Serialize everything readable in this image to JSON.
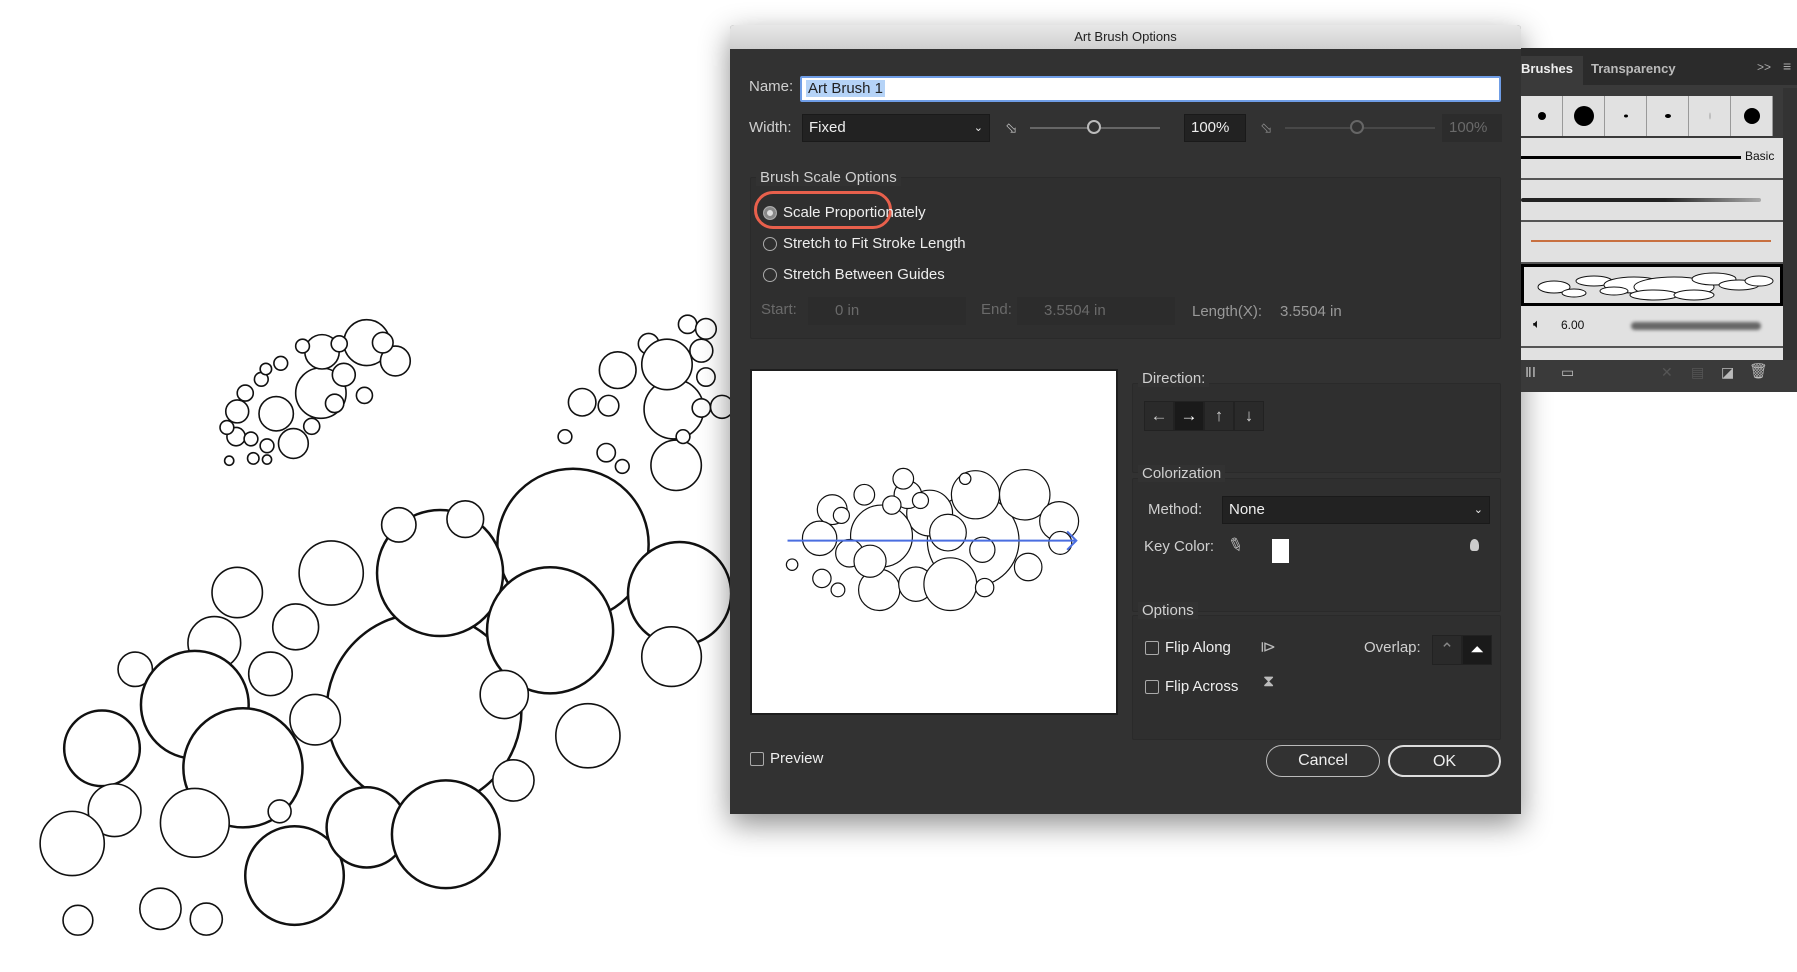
{
  "dialog": {
    "title": "Art Brush Options",
    "name_label": "Name:",
    "name_value": "Art Brush 1",
    "width_label": "Width:",
    "width_select": "Fixed",
    "width_percent": "100%",
    "width_percent_disabled": "100%",
    "brush_scale": {
      "label": "Brush Scale Options",
      "options": [
        {
          "label": "Scale Proportionately",
          "selected": true
        },
        {
          "label": "Stretch to Fit Stroke Length",
          "selected": false
        },
        {
          "label": "Stretch Between Guides",
          "selected": false
        }
      ],
      "start_label": "Start:",
      "start_value": "0 in",
      "end_label": "End:",
      "end_value": "3.5504 in",
      "length_label": "Length(X):",
      "length_value": "3.5504 in",
      "highlight_color": "#e8604c"
    },
    "direction": {
      "label": "Direction:",
      "buttons": [
        {
          "icon": "arrow-left",
          "glyph": "←"
        },
        {
          "icon": "arrow-right",
          "glyph": "→",
          "selected": true
        },
        {
          "icon": "arrow-up",
          "glyph": "↑"
        },
        {
          "icon": "arrow-down",
          "glyph": "↓"
        }
      ]
    },
    "colorization": {
      "label": "Colorization",
      "method_label": "Method:",
      "method_value": "None",
      "key_color_label": "Key Color:",
      "key_color": "#ffffff"
    },
    "options": {
      "label": "Options",
      "flip_along": "Flip Along",
      "flip_across": "Flip Across",
      "overlap_label": "Overlap:"
    },
    "preview_label": "Preview",
    "cancel": "Cancel",
    "ok": "OK",
    "preview_arrow_color": "#4a6ee0"
  },
  "panel": {
    "tabs": [
      "Brushes",
      "Transparency"
    ],
    "basic_label": "Basic",
    "brush_size": "6.00",
    "menu_icon": "menu-icon",
    "collapse_glyph": ">>"
  }
}
